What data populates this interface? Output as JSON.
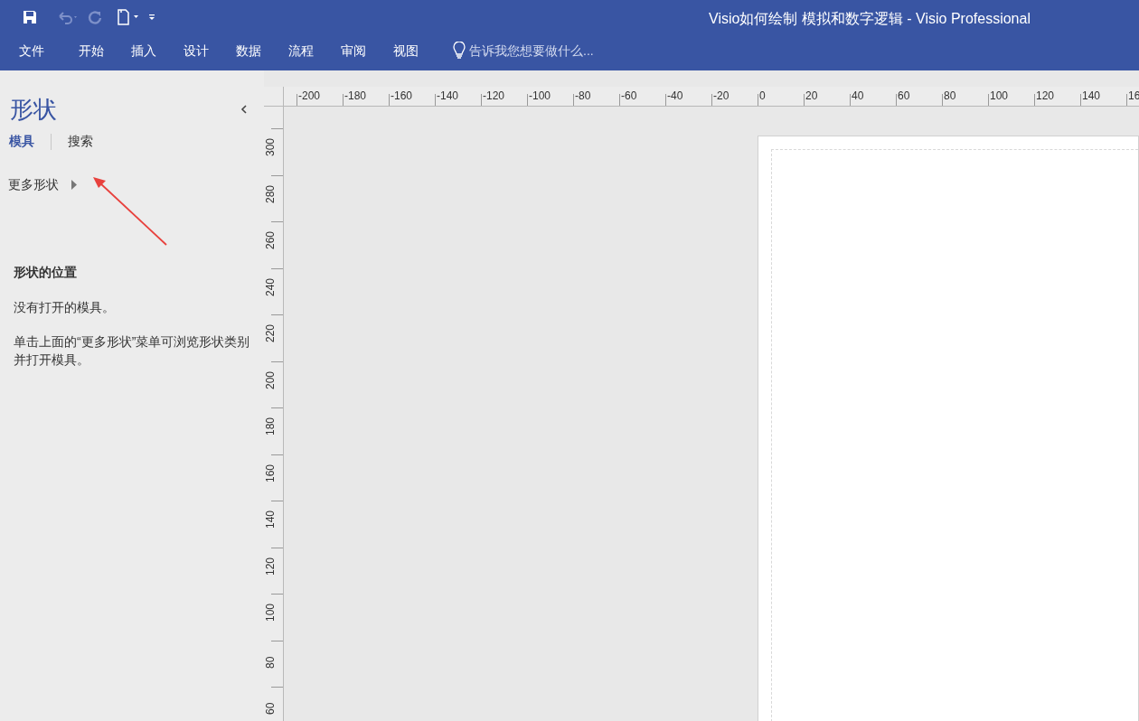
{
  "window": {
    "title": "Visio如何绘制 模拟和数字逻辑 - Visio Professional"
  },
  "ribbon_tabs": [
    "文件",
    "开始",
    "插入",
    "设计",
    "数据",
    "流程",
    "审阅",
    "视图"
  ],
  "tell_me": {
    "placeholder": "告诉我您想要做什么..."
  },
  "shapes_pane": {
    "title": "形状",
    "tabs": [
      {
        "label": "模具",
        "selected": true
      },
      {
        "label": "搜索",
        "selected": false
      }
    ],
    "more_shapes": "更多形状",
    "heading": "形状的位置",
    "paragraphs": [
      "没有打开的模具。",
      "单击上面的“更多形状”菜单可浏览形状类别并打开模具。"
    ]
  },
  "horizontal_ruler": [
    "-200",
    "-180",
    "-160",
    "-140",
    "-120",
    "-100",
    "-80",
    "-60",
    "-40",
    "-20",
    "0",
    "20",
    "40",
    "60",
    "80",
    "100",
    "120",
    "140",
    "16"
  ],
  "vertical_ruler": [
    "300",
    "280",
    "260",
    "240",
    "220",
    "200",
    "180",
    "160",
    "140",
    "120",
    "100",
    "80",
    "60"
  ]
}
